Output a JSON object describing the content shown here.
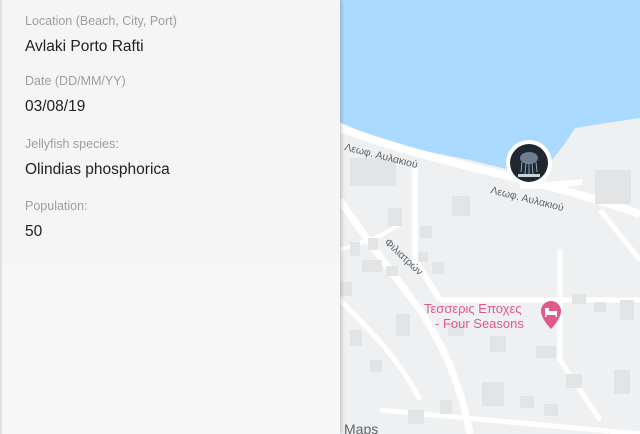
{
  "form": {
    "location_label": "Location (Beach, City, Port)",
    "location_value": "Avlaki Porto Rafti",
    "date_label": "Date (DD/MM/YY)",
    "date_value": "03/08/19",
    "species_label": "Jellyfish species:",
    "species_value": "Olindias phosphorica",
    "population_label": "Population:",
    "population_value": "50"
  },
  "map": {
    "road_label_1": "Λεωφ. Αυλακιού",
    "road_label_2": "Λεωφ. Αυλακιού",
    "road_label_3": "Φιλιατρών",
    "poi_label_line1": "Τεσσερις Εποχες",
    "poi_label_line2": "- Four Seasons",
    "attribution": "Maps",
    "poi_icon": "bed-icon",
    "marker_icon": "jellyfish-marker-icon",
    "colors": {
      "water": "#aadaff",
      "land": "#eef0f1",
      "road": "#ffffff",
      "building": "#e2e4e6",
      "poi": "#e1598b"
    }
  }
}
